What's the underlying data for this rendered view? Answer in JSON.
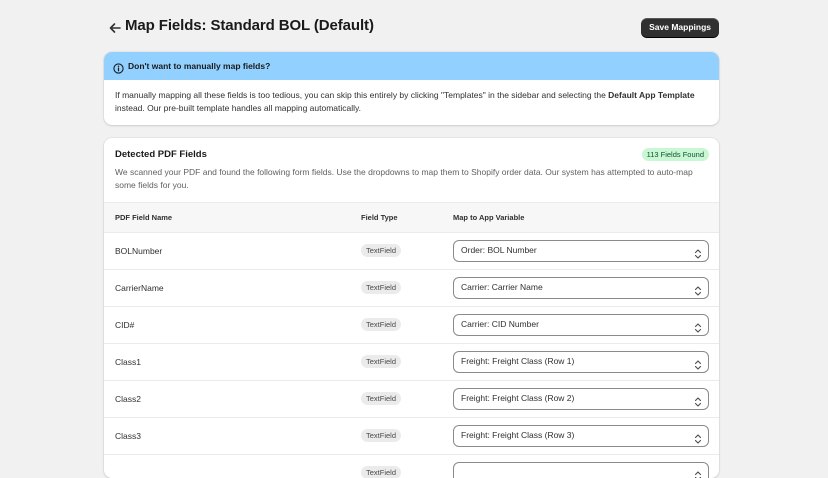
{
  "header": {
    "title": "Map Fields: Standard BOL (Default)",
    "save_label": "Save Mappings",
    "back_icon": "arrow-left-icon"
  },
  "banner": {
    "title": "Don't want to manually map fields?",
    "body_part1": "If manually mapping all these fields is too tedious, you can skip this entirely by clicking \"Templates\" in the sidebar and selecting the ",
    "body_bold": "Default App Template",
    "body_part2": " instead. Our pre-built template handles all mapping automatically.",
    "icon": "info-icon",
    "color": "#91d0ff"
  },
  "card": {
    "title": "Detected PDF Fields",
    "count_badge": "113 Fields Found",
    "description": "We scanned your PDF and found the following form fields. Use the dropdowns to map them to Shopify order data. Our system has attempted to auto-map some fields for you."
  },
  "table": {
    "headers": [
      "PDF Field Name",
      "Field Type",
      "Map to App Variable"
    ],
    "rows": [
      {
        "name": "BOLNumber",
        "type": "TextField",
        "mapping": "Order: BOL Number"
      },
      {
        "name": "CarrierName",
        "type": "TextField",
        "mapping": "Carrier: Carrier Name"
      },
      {
        "name": "CID#",
        "type": "TextField",
        "mapping": "Carrier: CID Number"
      },
      {
        "name": "Class1",
        "type": "TextField",
        "mapping": "Freight: Freight Class (Row 1)"
      },
      {
        "name": "Class2",
        "type": "TextField",
        "mapping": "Freight: Freight Class (Row 2)"
      },
      {
        "name": "Class3",
        "type": "TextField",
        "mapping": "Freight: Freight Class (Row 3)"
      },
      {
        "name": "",
        "type": "TextField",
        "mapping": ""
      }
    ]
  }
}
